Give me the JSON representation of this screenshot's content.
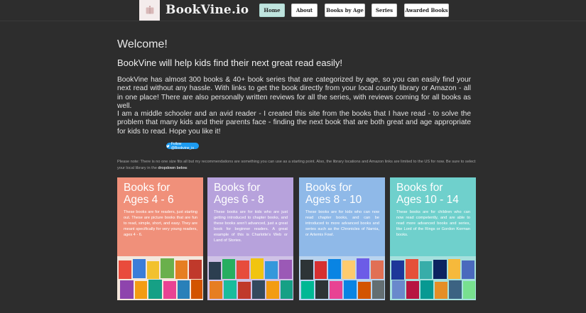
{
  "header": {
    "brand": "BookVine.io",
    "nav": [
      {
        "label": "Home",
        "active": true
      },
      {
        "label": "About",
        "active": false
      },
      {
        "label": "Books by Age",
        "active": false
      },
      {
        "label": "Series",
        "active": false
      },
      {
        "label": "Awarded Books",
        "active": false
      }
    ]
  },
  "main": {
    "welcome": "Welcome!",
    "tagline": "BookVine will help kids find their next great read easily!",
    "paragraph1": "BookVine has almost 300 books & 40+ book series that are categorized by age, so you can easily find your next read without any hassle. With links to get the book directly from your local county library or Amazon - all in one place! There are also personally written reviews for all the series, with reviews coming for all books as well.",
    "paragraph2": "I am a middle schooler and an avid reader - I created this site from the books that I have read - to solve the problem that many kids and their parents face - finding the next book that are both great and age appropriate for kids to read. Hope you like it!",
    "follow_button": "Follow @Bookvine_io",
    "note": "Please note: There is no one size fits all but my recommendations are something you can use as a starting point.   Also, the library locations and Amazon links are limited to the US for now. Be sure to select your local library in the",
    "note_link": "dropdown below",
    "note_end": "."
  },
  "cards": [
    {
      "title_line1": "Books for",
      "title_line2": "Ages 4 - 6",
      "description": "These books are for readers, just starting out. These are picture books that are fun to read, simple, short, and easy. They are meant specifically for very young readers, ages 4 - 6.",
      "color": "#f0907a"
    },
    {
      "title_line1": "Books for",
      "title_line2": "Ages 6 - 8",
      "description": "These books are for kids who are just getting introduced to chapter books, and these books aren't advanced, just a great book for beginner readers. A great example of this is Charlotte's Web or Land of Stories.",
      "color": "#b7a2dc"
    },
    {
      "title_line1": "Books for",
      "title_line2": "Ages 8 - 10",
      "description": "These books are for kids who can now read chapter books, and can be introduced to more advanced books and series such as the Chronicles of Narnia, or Artemis Fowl.",
      "color": "#8fb9e8"
    },
    {
      "title_line1": "Books for",
      "title_line2": "Ages 10 - 14",
      "description": "These books are for children who can now read competently, and are able to read more advanced books and series, like Lord of the Rings or Gordon Korman books.",
      "color": "#6fd0cc"
    }
  ]
}
